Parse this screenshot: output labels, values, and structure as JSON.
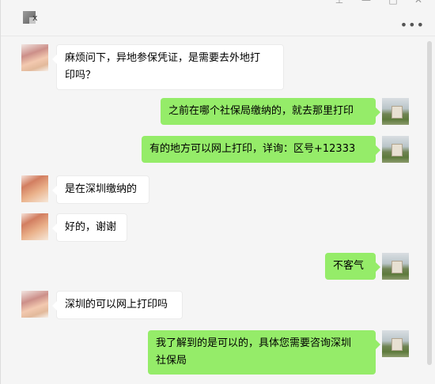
{
  "header": {
    "title_fragment": "x",
    "more_label": "•••",
    "window_controls": [
      "pin-icon",
      "minimize-icon",
      "maximize-icon",
      "close-icon"
    ]
  },
  "messages": [
    {
      "side": "left",
      "text_line1": "麻烦问下，异地参保凭证，是需要去外地打",
      "text_line2": "印吗？"
    },
    {
      "side": "right",
      "text": "之前在哪个社保局缴纳的，就去那里打印"
    },
    {
      "side": "right",
      "text": "有的地方可以网上打印，详询：区号+12333"
    },
    {
      "side": "left",
      "text": "是在深圳缴纳的"
    },
    {
      "side": "left",
      "text": "好的，谢谢"
    },
    {
      "side": "right",
      "text": "不客气"
    },
    {
      "side": "left",
      "text": "深圳的可以网上打印吗"
    },
    {
      "side": "right",
      "text_line1": "我了解到的是可以的，具体您需要咨询深圳",
      "text_line2": "社保局"
    }
  ],
  "colors": {
    "outgoing": "#95ec69",
    "incoming": "#ffffff",
    "background": "#f5f5f5"
  }
}
